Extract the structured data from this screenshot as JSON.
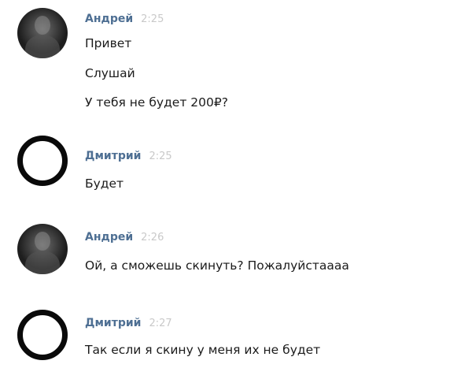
{
  "messages": [
    {
      "author": "Андрей",
      "time": "2:25",
      "avatar": "photo",
      "lines": [
        "Привет",
        "Слушай",
        "У тебя не будет 200₽?"
      ]
    },
    {
      "author": "Дмитрий",
      "time": "2:25",
      "avatar": "black-ring",
      "lines": [
        "Будет"
      ]
    },
    {
      "author": "Андрей",
      "time": "2:26",
      "avatar": "photo",
      "lines": [
        "Ой, а сможешь скинуть? Пожалуйстаааа"
      ]
    },
    {
      "author": "Дмитрий",
      "time": "2:27",
      "avatar": "black-ring",
      "lines": [
        "Так если я скину у меня их не будет"
      ]
    }
  ],
  "colors": {
    "author": "#4e6f93",
    "time": "#c9c9c9",
    "text": "#1b1b1b",
    "ring": "#0a0a0a"
  }
}
